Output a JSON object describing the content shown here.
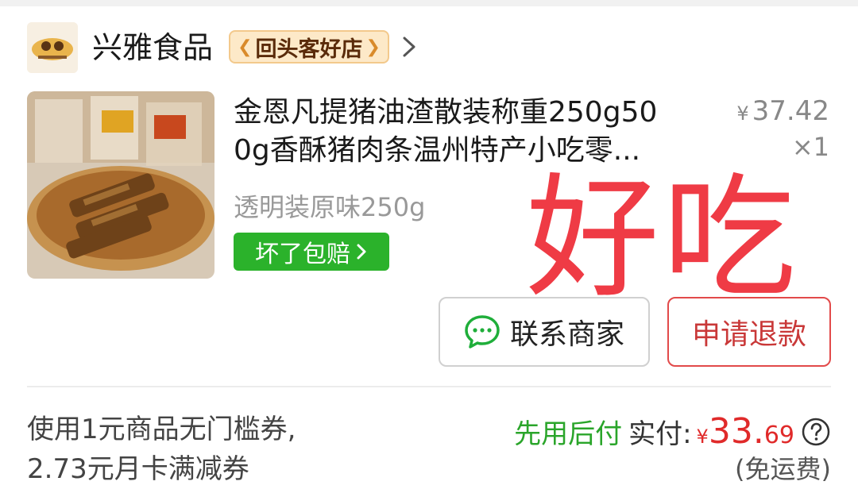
{
  "shop": {
    "name": "兴雅食品",
    "badge": "回头客好店"
  },
  "product": {
    "title_line1": "金恩凡提猪油渣散装称重250g50",
    "title_line2": "0g香酥猪肉条温州特产小吃零...",
    "price_symbol": "¥",
    "price": "37.42",
    "quantity": "×1",
    "spec": "透明装原味250g",
    "guarantee": "坏了包赔"
  },
  "overlay": {
    "text": "好吃",
    "color": "#ef3b45"
  },
  "actions": {
    "contact": "联系商家",
    "refund": "申请退款"
  },
  "summary": {
    "coupon_line1": "使用1元商品无门槛券,",
    "coupon_line2": "2.73元月卡满减券",
    "pay_later": "先用后付",
    "paid_label": "实付:",
    "paid_symbol": "¥",
    "paid_int": "33.",
    "paid_dec": "69",
    "shipping": "(免运费)"
  },
  "colors": {
    "accent_green": "#2bb22b",
    "price_red": "#e02a2a",
    "refund_red": "#c93838"
  },
  "icons": {
    "chat": "chat-bubble-icon",
    "help": "question-circle-icon",
    "chevron": "chevron-right-icon"
  }
}
